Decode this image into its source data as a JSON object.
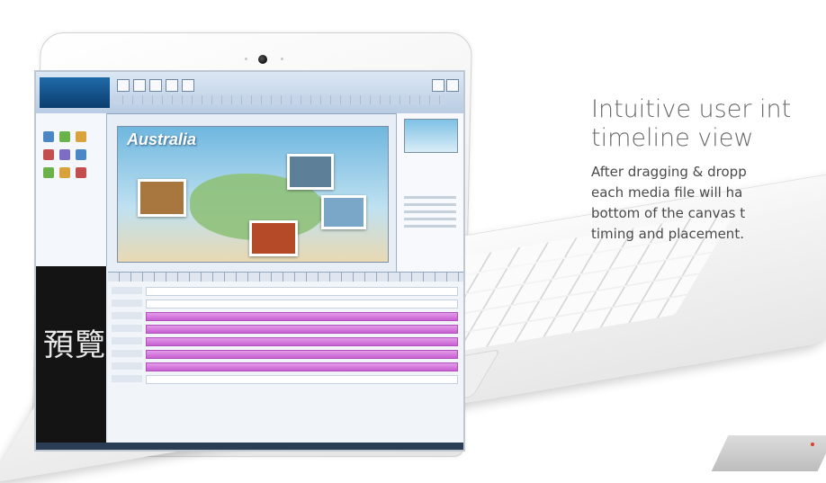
{
  "copy": {
    "headline_line1": "Intuitive user int",
    "headline_line2": "timeline view",
    "body_line1": "After dragging & dropp",
    "body_line2": "each media file will ha",
    "body_line3": "bottom of the canvas t",
    "body_line4": "timing and placement."
  },
  "screen": {
    "canvas_title": "Australia",
    "preview_label": "預覽"
  },
  "colors": {
    "headline": "#6a6a6a",
    "body": "#4a4a4a",
    "timeline_media_track": "#c860d2",
    "power_led": "#e23b2f"
  },
  "icons": [
    "camera-icon",
    "power-led-icon"
  ]
}
